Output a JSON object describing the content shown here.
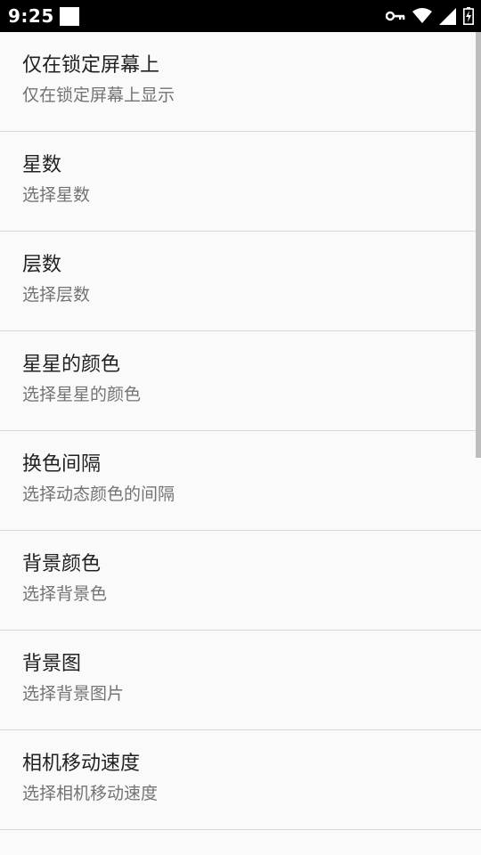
{
  "status_bar": {
    "time": "9:25",
    "icons": [
      "key-icon",
      "wifi-icon",
      "signal-icon",
      "battery-charging-icon"
    ]
  },
  "settings": {
    "items": [
      {
        "title": "仅在锁定屏幕上",
        "subtitle": "仅在锁定屏幕上显示"
      },
      {
        "title": "星数",
        "subtitle": "选择星数"
      },
      {
        "title": "层数",
        "subtitle": "选择层数"
      },
      {
        "title": "星星的颜色",
        "subtitle": "选择星星的颜色"
      },
      {
        "title": "换色间隔",
        "subtitle": "选择动态颜色的间隔"
      },
      {
        "title": "背景颜色",
        "subtitle": "选择背景色"
      },
      {
        "title": "背景图",
        "subtitle": "选择背景图片"
      },
      {
        "title": "相机移动速度",
        "subtitle": "选择相机移动速度"
      }
    ]
  },
  "colors": {
    "status_bar": "#000000",
    "background": "#fafafa",
    "divider": "#d9d9d9",
    "title_text": "#212121",
    "subtitle_text": "#737373",
    "scrollbar": "#bdbdbd"
  }
}
